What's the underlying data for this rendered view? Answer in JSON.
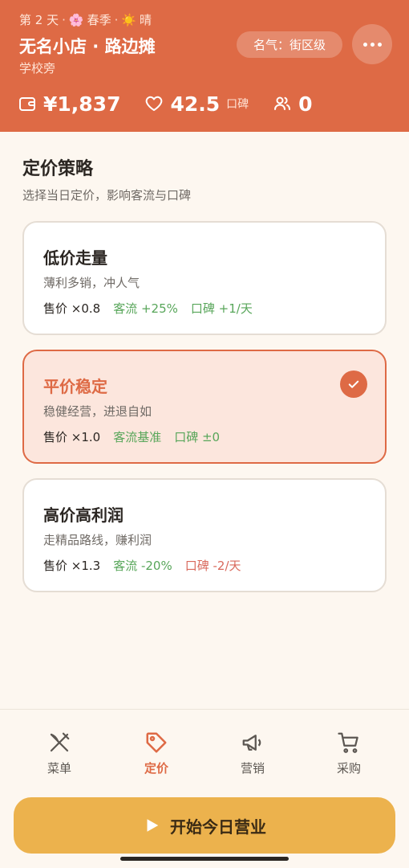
{
  "header": {
    "day": "第 2 天",
    "season_icon": "🌸",
    "season": "春季",
    "weather_icon": "☀️",
    "weather": "晴",
    "separator": "·",
    "shop_name": "无名小店 · 路边摊",
    "location": "学校旁",
    "fame": "名气：街区级",
    "money": "¥1,837",
    "reputation": "42.5",
    "reputation_unit": "口碑",
    "customers": "0"
  },
  "pricing": {
    "title": "定价策略",
    "subtitle": "选择当日定价，影响客流与口碑",
    "options": [
      {
        "title": "低价走量",
        "desc": "薄利多销，冲人气",
        "price": "售价 ×0.8",
        "traffic": "客流 +25%",
        "rep": "口碑 +1/天",
        "selected": false
      },
      {
        "title": "平价稳定",
        "desc": "稳健经营，进退自如",
        "price": "售价 ×1.0",
        "traffic": "客流基准",
        "rep": "口碑 ±0",
        "selected": true
      },
      {
        "title": "高价高利润",
        "desc": "走精品路线，赚利润",
        "price": "售价 ×1.3",
        "traffic": "客流 -20%",
        "rep": "口碑 -2/天",
        "selected": false
      }
    ]
  },
  "nav": {
    "items": [
      {
        "label": "菜单",
        "icon": "utensils-crossed-icon"
      },
      {
        "label": "定价",
        "icon": "price-tag-icon"
      },
      {
        "label": "营销",
        "icon": "megaphone-icon"
      },
      {
        "label": "采购",
        "icon": "shopping-cart-icon"
      }
    ],
    "active": "定价"
  },
  "start_button": {
    "label": "开始今日营业"
  },
  "colors": {
    "primary": "#de6a45",
    "accent": "#ecb24d",
    "good": "#58a65a",
    "bad": "#d9695c"
  }
}
